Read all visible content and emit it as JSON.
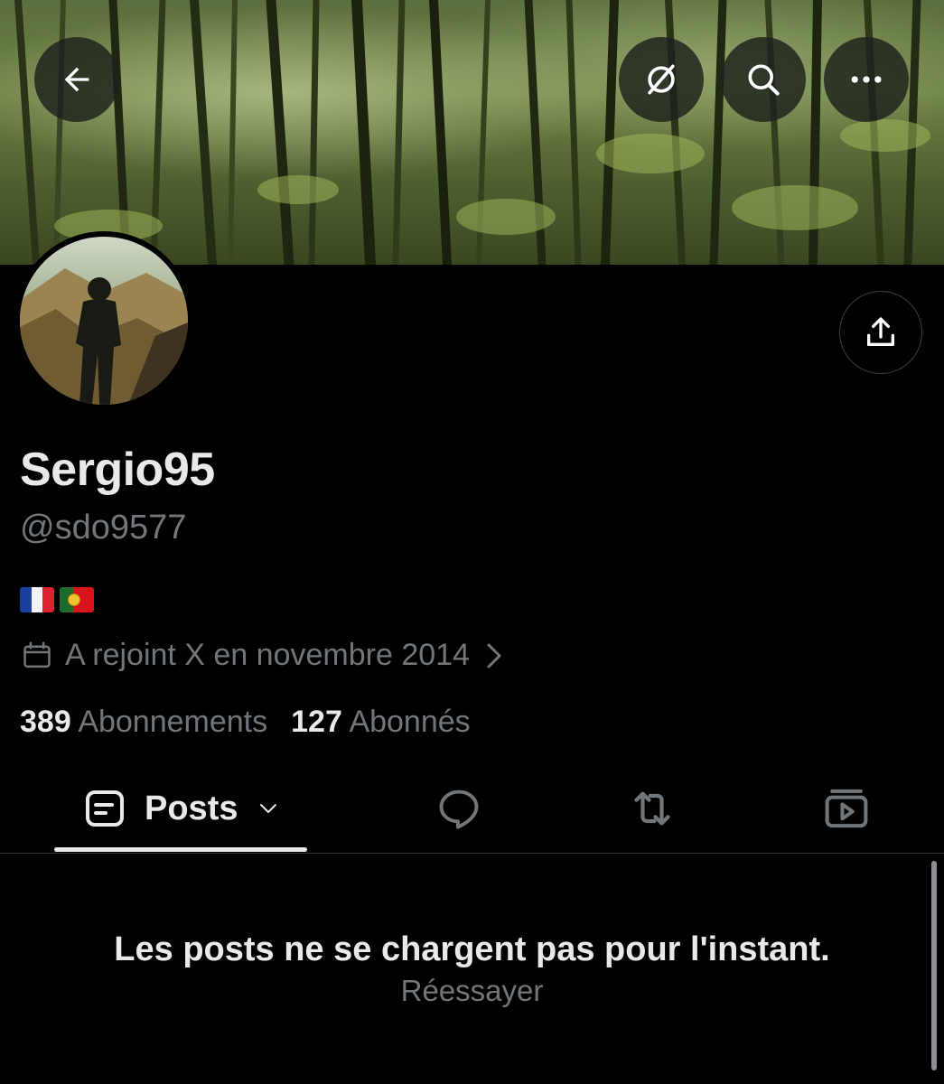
{
  "header": {
    "back_icon": "arrow-left-icon",
    "mute_icon": "circle-slash-icon",
    "search_icon": "search-icon",
    "more_icon": "ellipsis-icon"
  },
  "profile": {
    "display_name": "Sergio95",
    "handle": "@sdo9577",
    "bio_flags": [
      "France",
      "Portugal"
    ],
    "joined": "A rejoint X en novembre 2014",
    "following_count": "389",
    "following_label": "Abonnements",
    "followers_count": "127",
    "followers_label": "Abonnés"
  },
  "tabs": {
    "posts_label": "Posts",
    "replies_icon": "speech-bubble-icon",
    "reposts_icon": "repost-icon",
    "media_icon": "video-icon"
  },
  "feed": {
    "error_message": "Les posts ne se chargent pas pour l'instant.",
    "retry_label": "Réessayer"
  },
  "colors": {
    "background": "#000000",
    "primary_text": "#e7e9ea",
    "secondary_text": "#71767b",
    "divider": "#2f3336"
  }
}
